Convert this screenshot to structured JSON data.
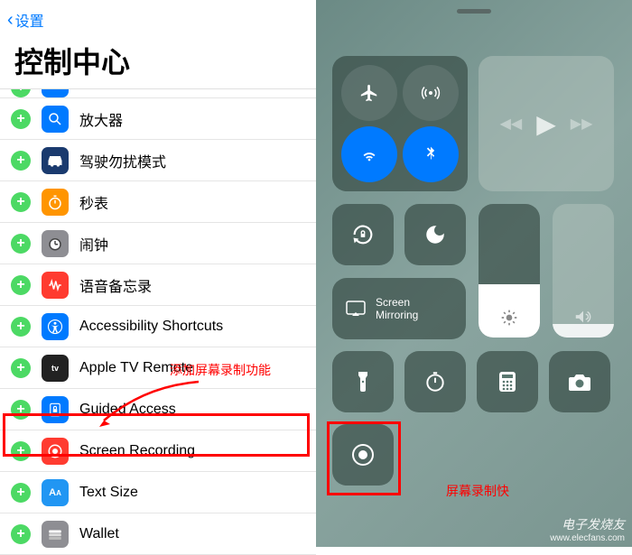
{
  "nav": {
    "back_label": "设置"
  },
  "title": "控制中心",
  "list": [
    {
      "label": "",
      "icon_color": "icon-blue",
      "icon_name": "blank-icon"
    },
    {
      "label": "放大器",
      "icon_color": "icon-blue",
      "icon_name": "magnifier-icon"
    },
    {
      "label": "驾驶勿扰模式",
      "icon_color": "icon-darkblue",
      "icon_name": "car-icon"
    },
    {
      "label": "秒表",
      "icon_color": "icon-orange",
      "icon_name": "stopwatch-icon"
    },
    {
      "label": "闹钟",
      "icon_color": "icon-gray",
      "icon_name": "alarm-icon"
    },
    {
      "label": "语音备忘录",
      "icon_color": "icon-red",
      "icon_name": "voice-memo-icon"
    },
    {
      "label": "Accessibility Shortcuts",
      "icon_color": "icon-blue",
      "icon_name": "accessibility-icon"
    },
    {
      "label": "Apple TV Remote",
      "icon_color": "icon-black",
      "icon_name": "apple-tv-icon"
    },
    {
      "label": "Guided Access",
      "icon_color": "icon-blue",
      "icon_name": "guided-access-icon"
    },
    {
      "label": "Screen Recording",
      "icon_color": "icon-red",
      "icon_name": "screen-recording-icon"
    },
    {
      "label": "Text Size",
      "icon_color": "icon-bluea",
      "icon_name": "text-size-icon"
    },
    {
      "label": "Wallet",
      "icon_color": "icon-gray",
      "icon_name": "wallet-icon"
    }
  ],
  "annotation": {
    "left_text": "添加屏幕录制功能",
    "right_text": "屏幕录制快"
  },
  "control_center": {
    "screen_mirroring": "Screen\nMirroring",
    "brightness_pct": 40,
    "volume_pct": 10
  },
  "watermark": {
    "brand": "电子发烧友",
    "url": "www.elecfans.com"
  }
}
